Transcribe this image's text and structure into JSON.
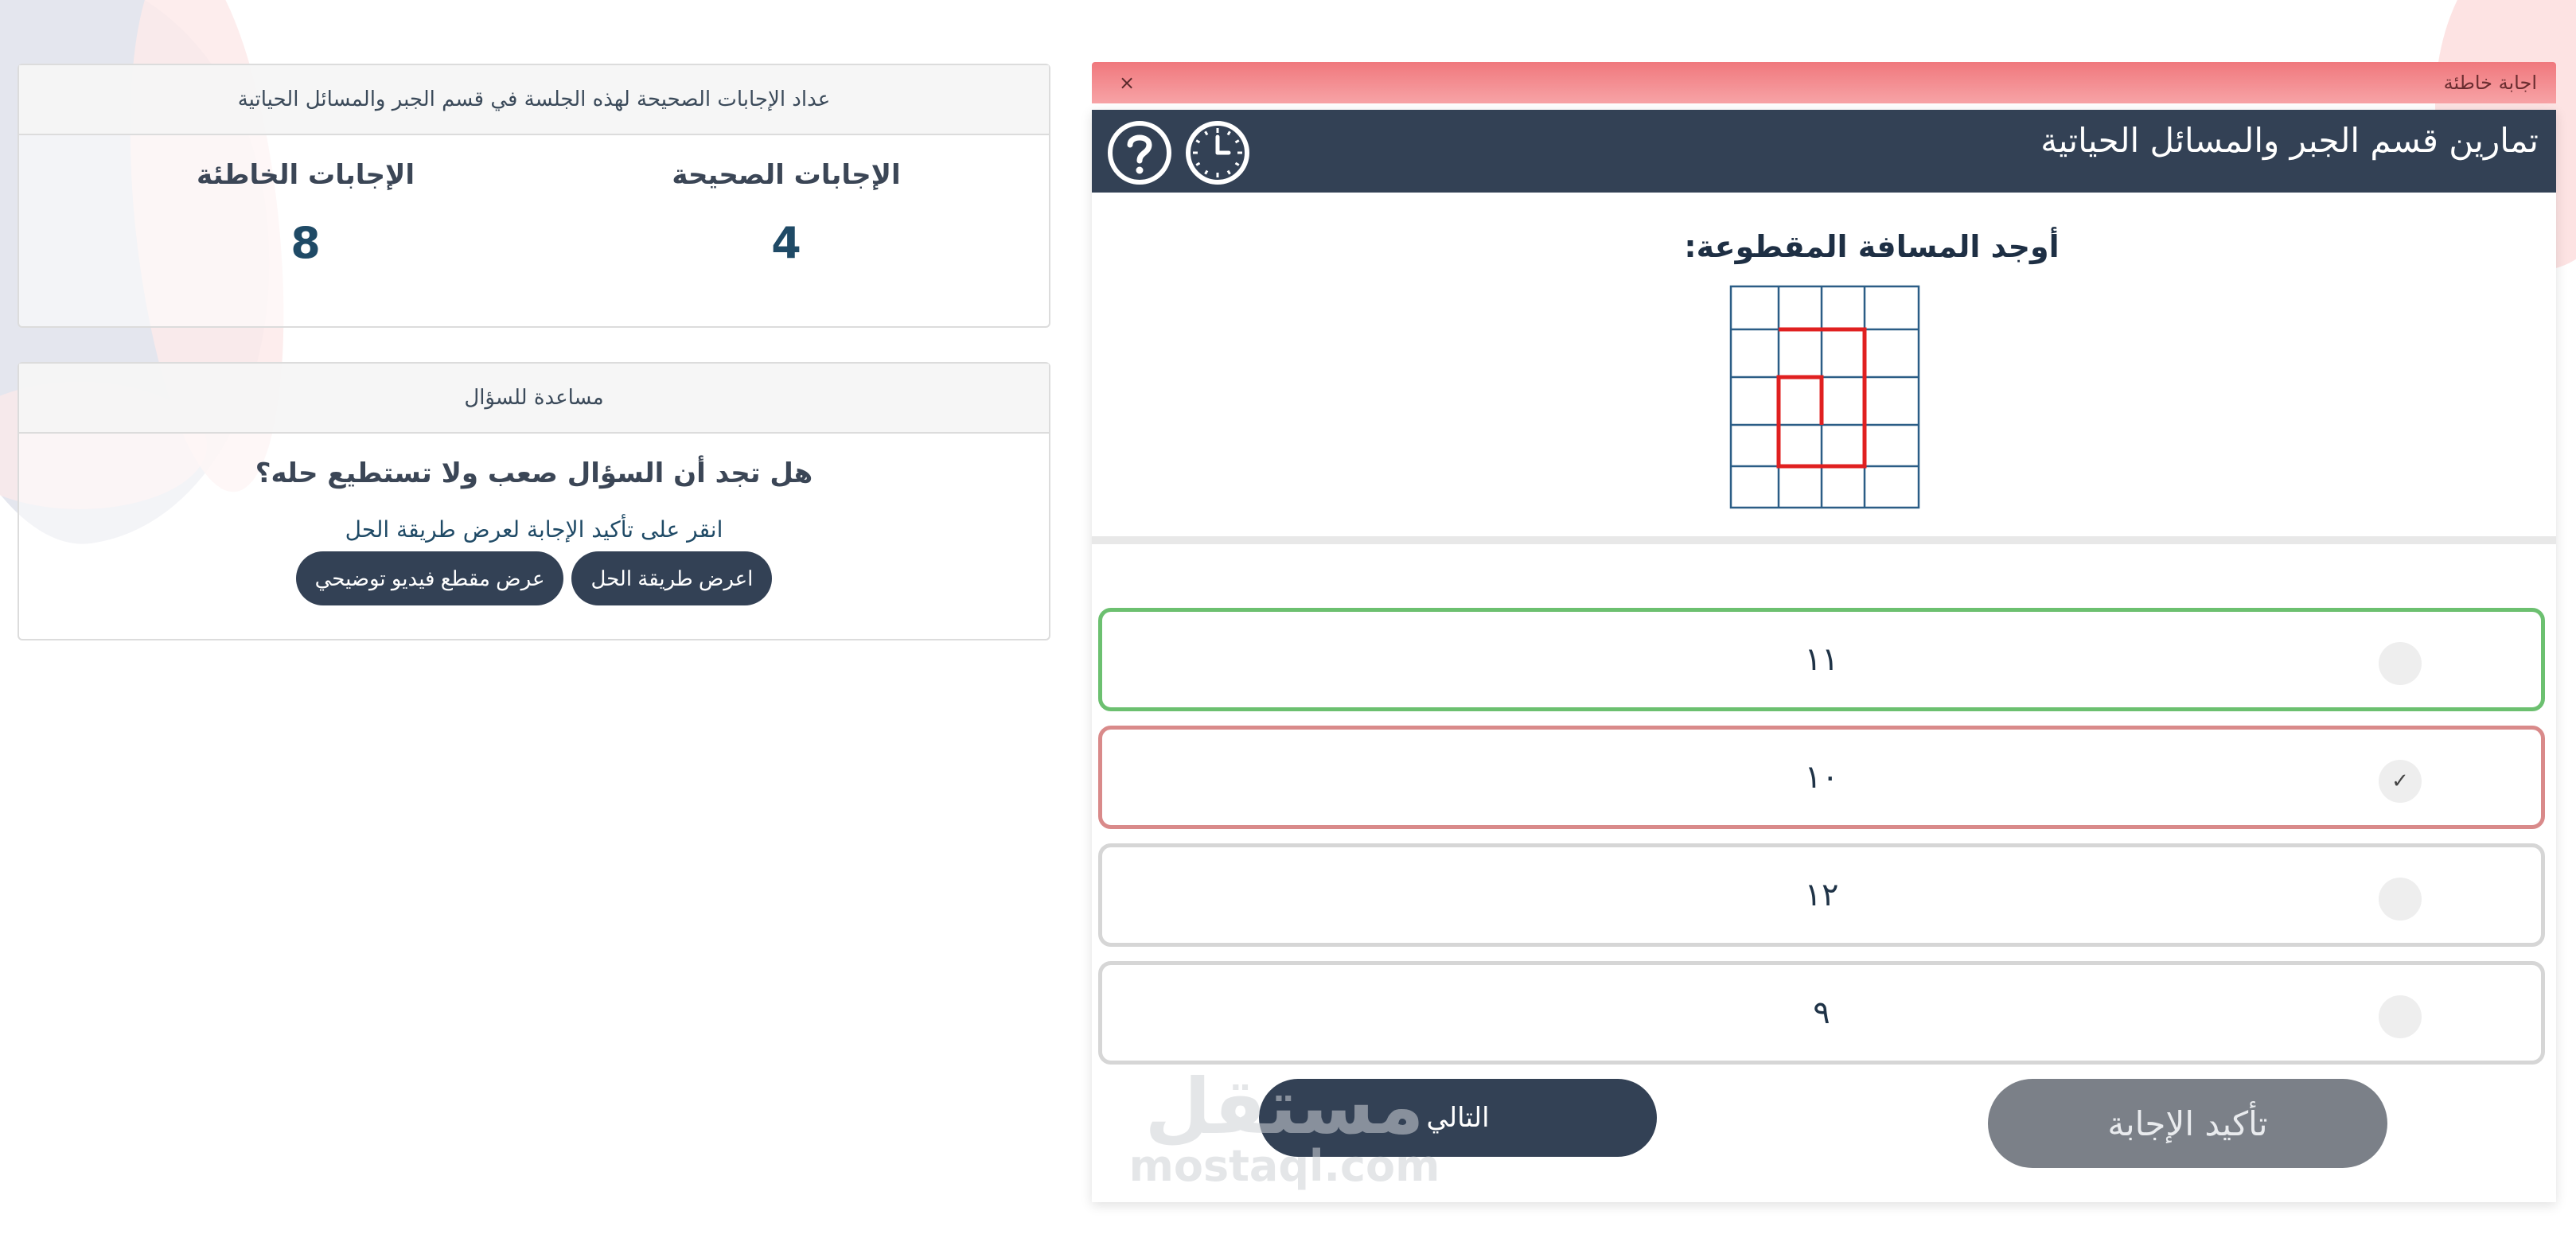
{
  "stats_panel": {
    "header": "عداد الإجابات الصحيحة لهذه الجلسة في قسم الجبر والمسائل الحياتية",
    "correct_label": "الإجابات الصحيحة",
    "correct_value": "4",
    "wrong_label": "الإجابات الخاطئة",
    "wrong_value": "8"
  },
  "help_panel": {
    "header": "مساعدة للسؤال",
    "question": "هل تجد أن السؤال صعب ولا تستطيع حله؟",
    "hint": "انقر على تأكيد الإجابة لعرض طريقة الحل",
    "show_solution_label": "اعرض طريقة الحل",
    "show_video_label": "عرض مقطع فيديو توضيحي"
  },
  "alert": {
    "text": "اجابة خاطئة",
    "close": "×"
  },
  "quiz": {
    "title": "تمارين قسم الجبر والمسائل الحياتية",
    "help_icon": "question-circle-icon",
    "timer_icon": "clock-icon",
    "question": "أوجد المسافة المقطوعة:",
    "options": [
      {
        "label": "١١",
        "state": "correct",
        "checked": false
      },
      {
        "label": "١٠",
        "state": "wrong",
        "checked": true,
        "check_mark": "✓"
      },
      {
        "label": "١٢",
        "state": "neutral",
        "checked": false
      },
      {
        "label": "٩",
        "state": "neutral",
        "checked": false
      }
    ],
    "next_label": "التالي",
    "confirm_label": "تأكيد الإجابة"
  },
  "watermark": {
    "brand": "مستقل",
    "domain": "mostaql.com"
  },
  "colors": {
    "header_bg": "#334155",
    "correct_border": "#6cc070",
    "wrong_border": "#d98a8a",
    "alert_bg": "#f0787d",
    "path_red": "#e02020",
    "grid_blue": "#2b5d86"
  }
}
